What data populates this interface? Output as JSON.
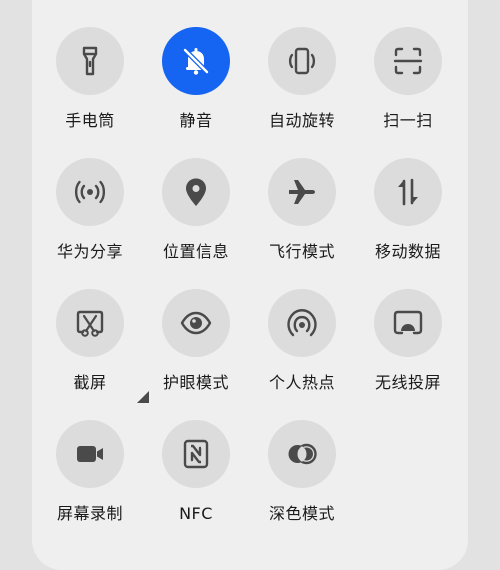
{
  "tiles": [
    {
      "label": "手电筒",
      "icon": "flashlight-icon",
      "active": false
    },
    {
      "label": "静音",
      "icon": "mute-bell-icon",
      "active": true
    },
    {
      "label": "自动旋转",
      "icon": "auto-rotate-icon",
      "active": false
    },
    {
      "label": "扫一扫",
      "icon": "scan-icon",
      "active": false
    },
    {
      "label": "华为分享",
      "icon": "huawei-share-icon",
      "active": false
    },
    {
      "label": "位置信息",
      "icon": "location-pin-icon",
      "active": false
    },
    {
      "label": "飞行模式",
      "icon": "airplane-icon",
      "active": false
    },
    {
      "label": "移动数据",
      "icon": "mobile-data-icon",
      "active": false
    },
    {
      "label": "截屏",
      "icon": "screenshot-icon",
      "active": false
    },
    {
      "label": "护眼模式",
      "icon": "eye-comfort-icon",
      "active": false
    },
    {
      "label": "个人热点",
      "icon": "hotspot-icon",
      "active": false
    },
    {
      "label": "无线投屏",
      "icon": "wireless-projection-icon",
      "active": false
    },
    {
      "label": "屏幕录制",
      "icon": "screen-record-icon",
      "active": false
    },
    {
      "label": "NFC",
      "icon": "nfc-icon",
      "active": false
    },
    {
      "label": "深色模式",
      "icon": "dark-mode-icon",
      "active": false
    }
  ],
  "colors": {
    "accent": "#1564f2",
    "tile_bg": "#dcdcdc",
    "icon": "#4a4a4a"
  }
}
